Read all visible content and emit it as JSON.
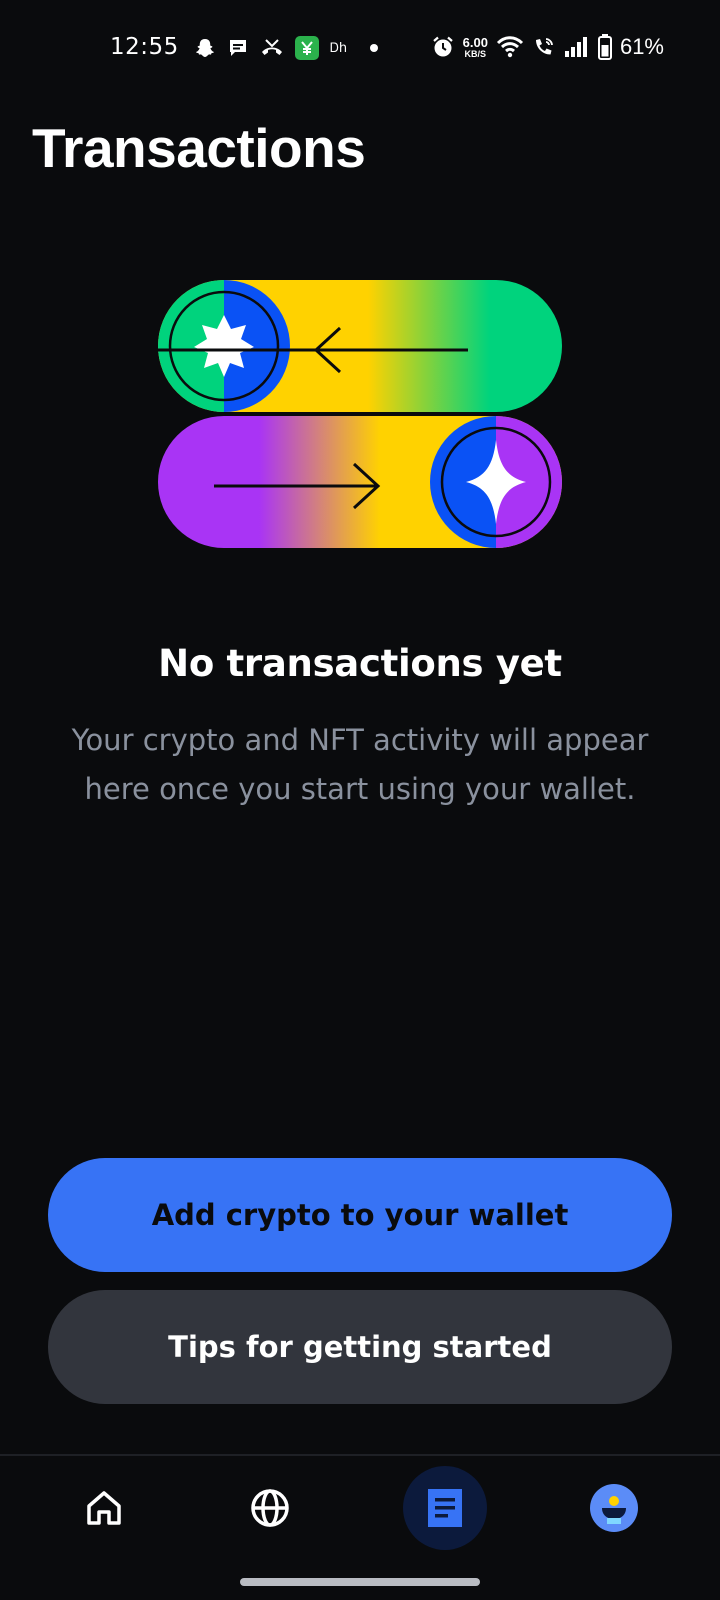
{
  "status_bar": {
    "time": "12:55",
    "left_icons": [
      "snapchat-icon",
      "chat-bubble-icon",
      "missed-call-icon",
      "app-notification-icon",
      "ph-text-icon",
      "dot-icon"
    ],
    "ph_label": "Ꭰh",
    "speed_value": "6.00",
    "speed_unit": "KB/S",
    "battery_percent": "61%"
  },
  "page": {
    "title": "Transactions"
  },
  "empty_state": {
    "heading": "No transactions yet",
    "body": "Your crypto and NFT activity will appear here once you start using your wallet."
  },
  "actions": {
    "primary_label": "Add crypto to your wallet",
    "secondary_label": "Tips for getting started"
  },
  "bottom_nav": {
    "items": [
      {
        "name": "home",
        "icon": "home-icon",
        "active": false
      },
      {
        "name": "browser",
        "icon": "globe-icon",
        "active": false
      },
      {
        "name": "transactions",
        "icon": "document-icon",
        "active": true
      },
      {
        "name": "profile",
        "icon": "avatar-icon",
        "active": false
      }
    ]
  },
  "colors": {
    "background": "#0a0b0d",
    "primary_button": "#3773f5",
    "secondary_button": "#32353d",
    "body_text": "#8a919e",
    "green": "#00d37d",
    "yellow": "#ffd200",
    "purple": "#a934f5",
    "blue": "#0a52f5"
  }
}
